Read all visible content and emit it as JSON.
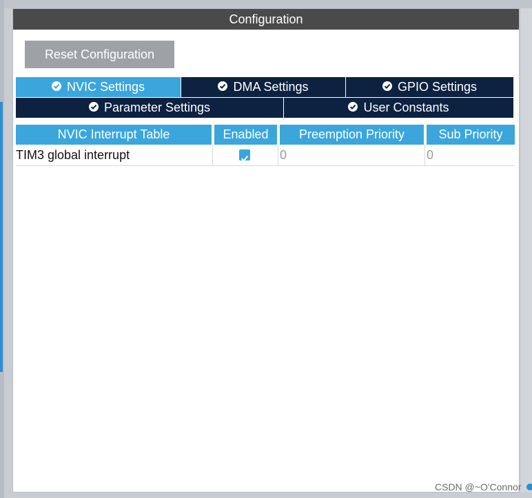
{
  "panel": {
    "title": "Configuration",
    "reset_label": "Reset Configuration"
  },
  "tabs": [
    {
      "label": "NVIC Settings",
      "active": true
    },
    {
      "label": "DMA Settings",
      "active": false
    },
    {
      "label": "GPIO Settings",
      "active": false
    },
    {
      "label": "Parameter Settings",
      "active": false
    },
    {
      "label": "User Constants",
      "active": false
    }
  ],
  "table": {
    "headers": [
      "NVIC Interrupt Table",
      "Enabled",
      "Preemption Priority",
      "Sub Priority"
    ],
    "rows": [
      {
        "name": "TIM3 global interrupt",
        "enabled": true,
        "preemption": "0",
        "sub": "0"
      }
    ]
  },
  "watermark": "CSDN @~O'Connor",
  "colors": {
    "accent": "#3aa6dc",
    "tab_dark": "#0d2240",
    "header_dark": "#4a4a4a",
    "button_gray": "#9ea2a6"
  },
  "icons": {
    "tab_icon": "check-circle-icon",
    "row_checkbox": "checkbox-checked-icon"
  }
}
